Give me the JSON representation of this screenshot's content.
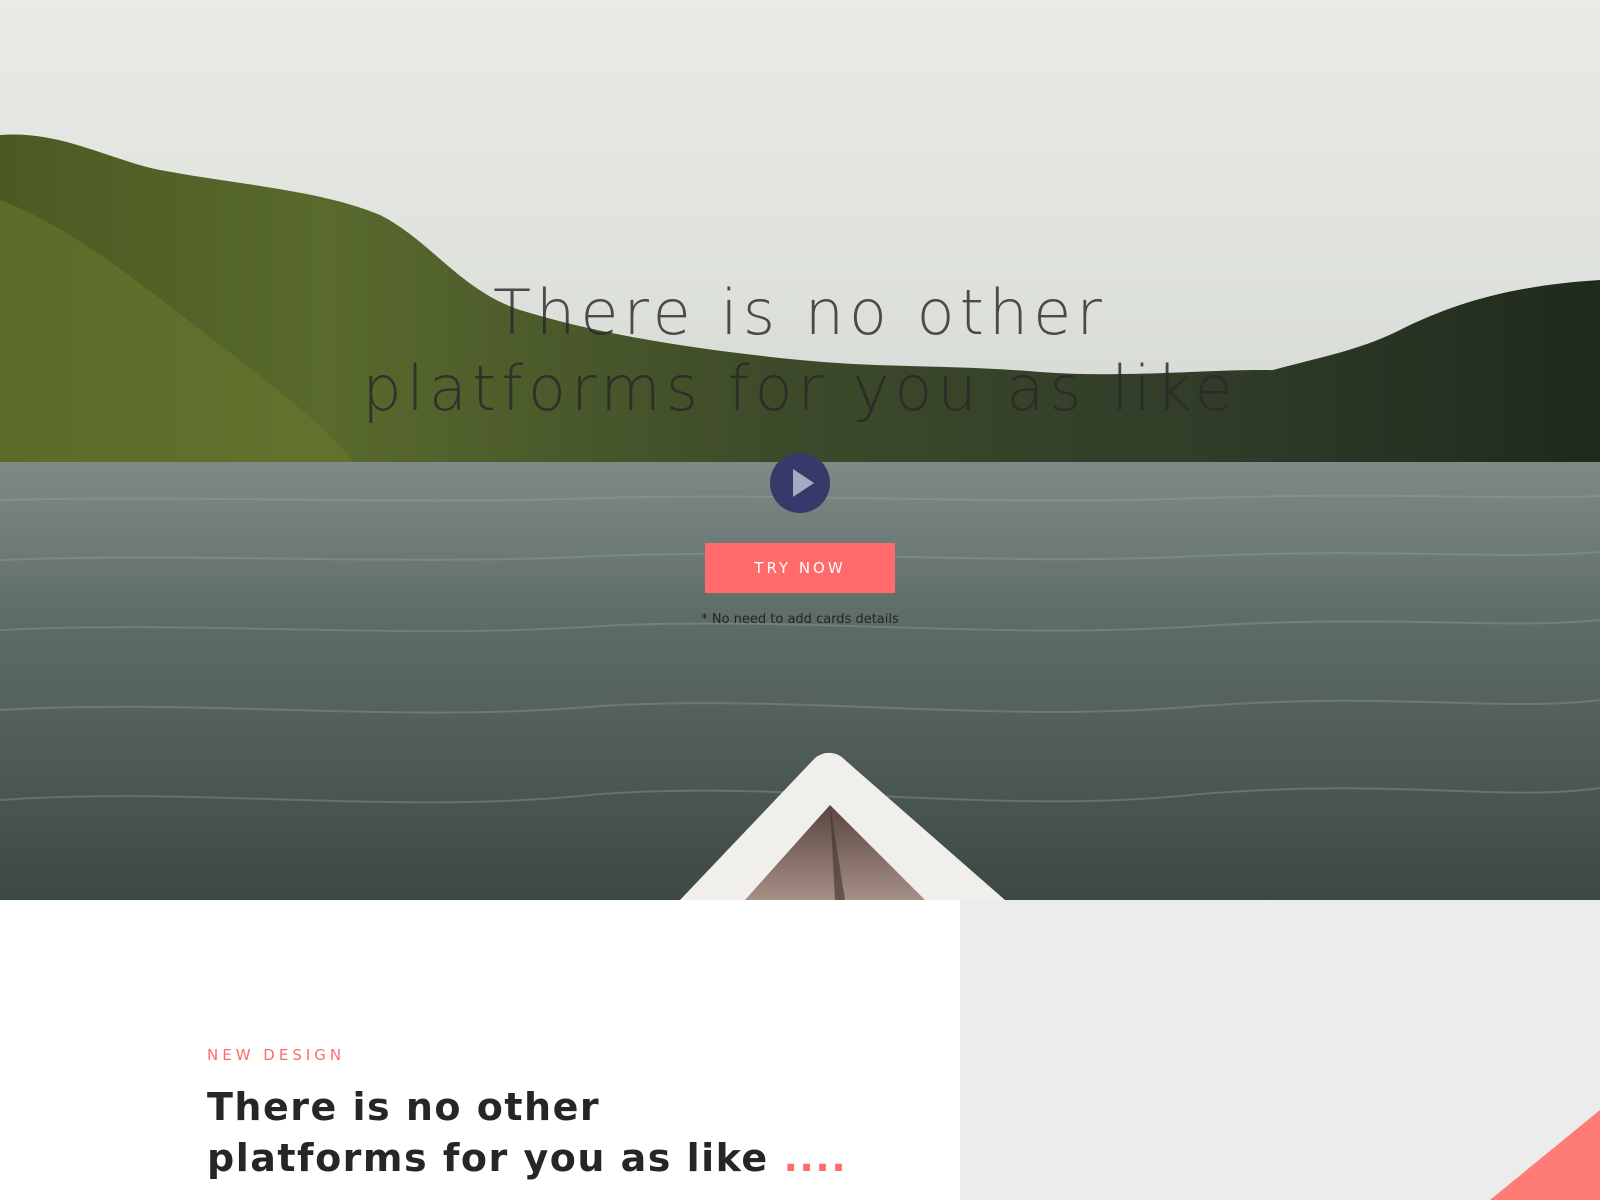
{
  "hero": {
    "title_line1": "There is no other",
    "title_line2": "platforms for you as like",
    "play_icon": "play-icon",
    "cta_label": "TRY NOW",
    "note": "* No need to add cards details"
  },
  "feature": {
    "eyebrow": "NEW DESIGN",
    "title_line1": "There is no other",
    "title_line2": "platforms for you as like",
    "title_accent": "...."
  },
  "colors": {
    "accent": "#ff6b6b",
    "play_button": "#363a6b",
    "panel_gray": "#ececec",
    "heading": "#262626"
  }
}
